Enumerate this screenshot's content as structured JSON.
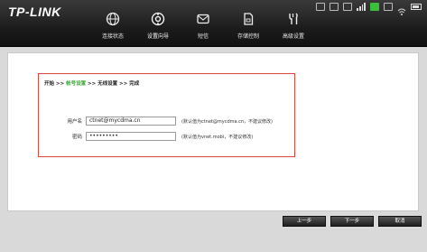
{
  "brand": {
    "logo_text": "TP-LINK"
  },
  "status_icons": [
    "message-icon",
    "sim-icon",
    "network-icon",
    "signal-bars-icon",
    "green-status-icon",
    "usb-icon",
    "wifi-icon",
    "battery-icon"
  ],
  "nav": {
    "items": [
      {
        "label": "连接状态",
        "icon": "globe-icon"
      },
      {
        "label": "设置向导",
        "icon": "gear-icon"
      },
      {
        "label": "短信",
        "icon": "envelope-icon"
      },
      {
        "label": "存储控制",
        "icon": "sd-card-icon"
      },
      {
        "label": "高级设置",
        "icon": "tools-icon"
      }
    ],
    "active_index": 1
  },
  "wizard": {
    "breadcrumb": {
      "step1": "开始",
      "sep1": " >> ",
      "step2": "帐号设置",
      "sep2": " >> ",
      "step3": "无线设置",
      "sep3": " >> ",
      "step4": "完成"
    },
    "username": {
      "label": "用户名",
      "value": "ctnet@mycdma.cn",
      "hint": "(默认值为ctnet@mycdma.cn，不建议修改)"
    },
    "password": {
      "label": "密码",
      "value": "•••••••••",
      "hint": "(默认值为vnet.mobi，不建议修改)"
    }
  },
  "buttons": {
    "prev": "上一步",
    "next": "下一步",
    "cancel": "取消"
  },
  "colors": {
    "accent_green": "#3aaa35",
    "highlight_border": "#e0463c",
    "topbar": "#1c1c1c"
  }
}
